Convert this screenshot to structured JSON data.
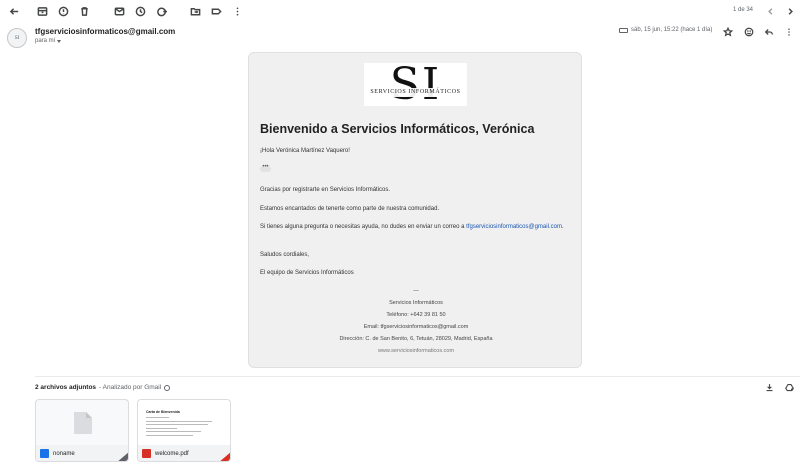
{
  "toolbar": {
    "pager": "1 de 34",
    "icons": [
      "back-arrow",
      "archive",
      "report-spam",
      "delete",
      "mark-unread",
      "snooze",
      "add-to-tasks",
      "move-to",
      "labels",
      "more"
    ]
  },
  "message": {
    "avatar_initials": "SI",
    "sender": "tfgserviciosinformaticos@gmail.com",
    "to_me": "para mí",
    "date": "sáb, 15 jun, 15:22 (hace 1 día)"
  },
  "email": {
    "logo_text": "SI",
    "logo_subtitle": "SERVICIOS INFORMÁTICOS",
    "heading": "Bienvenido a Servicios Informáticos, Verónica",
    "greeting": "¡Hola Verónica Martínez Vaquero!",
    "ellipsis": "•••",
    "p1": "Gracias por registrarte en Servicios Informáticos.",
    "p2": "Estamos encantados de tenerte como parte de nuestra comunidad.",
    "p3_prefix": "Si tienes alguna pregunta o necesitas ayuda, no dudes en enviar un correo a ",
    "p3_link": "tfgserviciosinformaticos@gmail.com",
    "p3_suffix": ".",
    "p4": "Saludos cordiales,",
    "p5": "El equipo de Servicios Informáticos",
    "footer": {
      "sep": "—",
      "company": "Servicios Informáticos",
      "phone": "Teléfono: +642 39 81 50",
      "email": "Email: tfgserviciosinformaticos@gmail.com",
      "address": "Dirección: C. de San Benito, 6, Tetuán, 28029, Madrid, España",
      "web": "www.serviciosinformaticos.com"
    }
  },
  "attachments": {
    "title": "2 archivos adjuntos",
    "scanned": "- Analizado por Gmail",
    "items": [
      {
        "name": "noname",
        "type": "doc"
      },
      {
        "name": "welcome.pdf",
        "type": "pdf",
        "preview_title": "Carta de Bienvenida"
      }
    ]
  },
  "colors": {
    "link": "#1a56b0",
    "pdf_red": "#d93025",
    "doc_blue": "#1a73e8",
    "card_bg": "#f0f0f0"
  }
}
